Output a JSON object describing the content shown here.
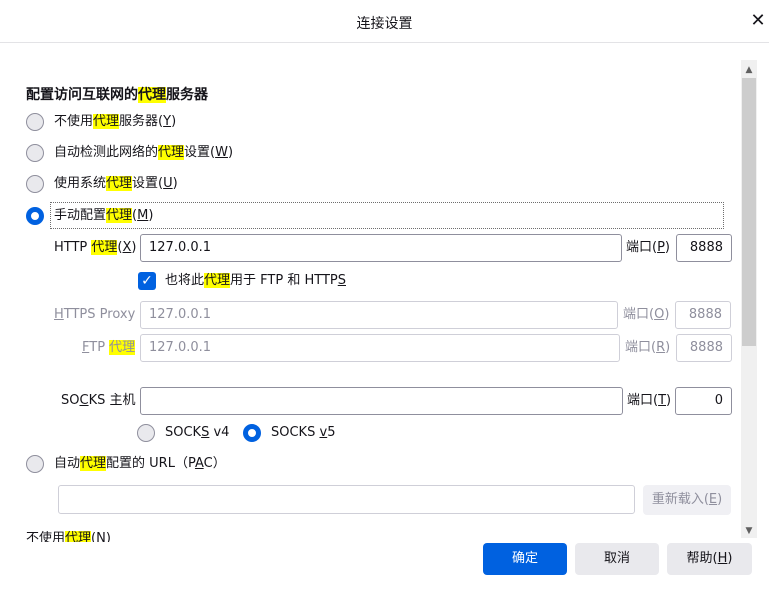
{
  "dialog": {
    "title": "连接设置",
    "close_glyph": "✕"
  },
  "section_title": {
    "prefix": "配置访问互联网的",
    "highlight": "代理",
    "suffix": "服务器"
  },
  "options": [
    {
      "prefix": "不使用",
      "highlight": "代理",
      "suffix": "服务器(",
      "key": "Y",
      "end": ")",
      "checked": false
    },
    {
      "prefix": "自动检测此网络的",
      "highlight": "代理",
      "suffix": "设置(",
      "key": "W",
      "end": ")",
      "checked": false
    },
    {
      "prefix": "使用系统",
      "highlight": "代理",
      "suffix": "设置(",
      "key": "U",
      "end": ")",
      "checked": false
    },
    {
      "prefix": "手动配置",
      "highlight": "代理",
      "suffix": "(",
      "key": "M",
      "end": ")",
      "checked": true
    }
  ],
  "http": {
    "prefix": "HTTP ",
    "highlight": "代理",
    "open": "(",
    "key": "X",
    "end": ")",
    "value": "127.0.0.1",
    "port_label": "端口(",
    "port_key": "P",
    "port_end": ")",
    "port": "8888"
  },
  "also_use": {
    "prefix": "也将此",
    "highlight": "代理",
    "middle": "用于 FTP 和 HTTP",
    "key": "S",
    "checked_glyph": "✓"
  },
  "https": {
    "key": "H",
    "label": "TTPS Proxy",
    "value": "127.0.0.1",
    "port_label": "端口(",
    "port_key": "O",
    "port_end": ")",
    "port": "8888"
  },
  "ftp": {
    "key": "F",
    "label": "TP ",
    "highlight": "代理",
    "value": "127.0.0.1",
    "port_label": "端口(",
    "port_key": "R",
    "port_end": ")",
    "port": "8888"
  },
  "socks": {
    "pre": "SO",
    "key": "C",
    "post": "KS 主机",
    "value": "",
    "port_label": "端口(",
    "port_key": "T",
    "port_end": ")",
    "port": "0",
    "v4_pre": "SOCK",
    "v4_key": "S",
    "v4_post": " v4",
    "v5_pre": "SOCKS ",
    "v5_key": "v",
    "v5_post": "5"
  },
  "pac": {
    "prefix": "自动",
    "highlight": "代理",
    "suffix": "配置的 URL（P",
    "key": "A",
    "end": "C）",
    "value": "",
    "reload_pre": "重新载入(",
    "reload_key": "E",
    "reload_end": ")"
  },
  "cutoff": {
    "prefix": "不使用",
    "highlight": "代理",
    "suffix": "(N)"
  },
  "buttons": {
    "ok": "确定",
    "cancel": "取消",
    "help_pre": "帮助(",
    "help_key": "H",
    "help_end": ")"
  },
  "scroll": {
    "up_glyph": "▲",
    "down_glyph": "▼"
  },
  "colors": {
    "accent": "#0061e0",
    "highlight": "#ffff00"
  }
}
